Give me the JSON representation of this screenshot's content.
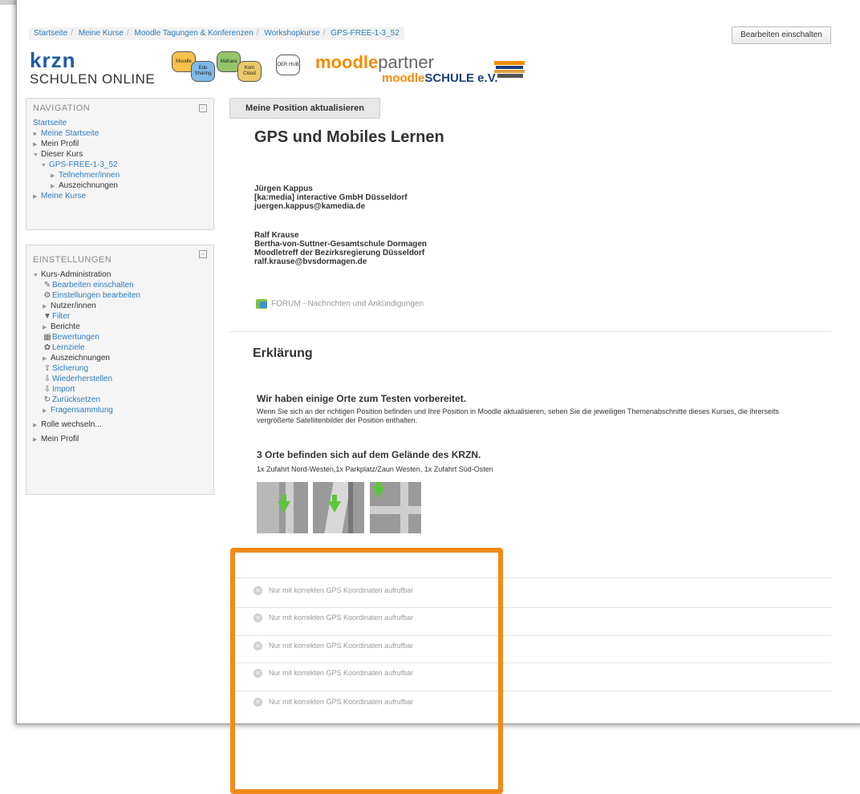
{
  "breadcrumb": [
    "Startseite",
    "Meine Kurse",
    "Moodle Tagungen & Konferenzen",
    "Workshopkurse",
    "GPS-FREE-1-3_52"
  ],
  "header": {
    "edit_button": "Bearbeiten einschalten",
    "logo_krzn": "krzn",
    "logo_schulen": "SCHULEN ONLINE",
    "badges": [
      "Moodle",
      "Edu Sharing",
      "Mahara",
      "Kom Cloud",
      "OER HUB"
    ],
    "logo_partner_a": "moodle",
    "logo_partner_b": "partner",
    "logo_schule_a": "moodle",
    "logo_schule_b": "SCHULE e.V."
  },
  "navigation": {
    "title": "NAVIGATION",
    "items": [
      "Startseite",
      "Meine Startseite",
      "Mein Profil",
      "Dieser Kurs",
      "GPS-FREE-1-3_52",
      "Teilnehmer/innen",
      "Auszeichnungen",
      "Meine Kurse"
    ]
  },
  "settings": {
    "title": "EINSTELLUNGEN",
    "items": [
      "Kurs-Administration",
      "Bearbeiten einschalten",
      "Einstellungen bearbeiten",
      "Nutzer/innen",
      "Filter",
      "Berichte",
      "Bewertungen",
      "Lernziele",
      "Auszeichnungen",
      "Sicherung",
      "Wiederherstellen",
      "Import",
      "Zurücksetzen",
      "Fragensammlung",
      "Rolle wechseln...",
      "Mein Profil"
    ]
  },
  "main": {
    "position_button": "Meine Position aktualisieren",
    "title": "GPS und Mobiles Lernen",
    "person1": [
      "Jürgen Kappus",
      "[ka:media] interactive GmbH Düsseldorf",
      "juergen.kappus@kamedia.de"
    ],
    "person2": [
      "Ralf Krause",
      "Bertha-von-Suttner-Gesamtschule Dormagen",
      "Moodletreff der Bezirksregierung Düsseldorf",
      "ralf.krause@bvsdormagen.de"
    ],
    "forum": "FORUM - Nachrichten und Ankündigungen",
    "section_title": "Erklärung",
    "heading1": "Wir haben einige Orte zum Testen vorbereitet.",
    "para1": "Wenn Sie sich an der richtigen Position befinden und Ihre Position in Moodle aktualisieren, sehen Sie die jeweiligen Themenabschnitte dieses Kurses, die ihrerseits vergrößerte Satellitenbilder der Position enthalten.",
    "heading2": "3 Orte befinden sich auf dem Gelände des KRZN.",
    "para2": "1x Zufahrt Nord-Westen,1x Parkplatz/Zaun Westen, 1x Zufahrt Süd-Osten",
    "locked_sections": [
      "Nur mit korrekten GPS Koordinaten aufrufbar",
      "Nur mit korrekten GPS Koordinaten aufrufbar",
      "Nur mit korrekten GPS Koordinaten aufrufbar",
      "Nur mit korrekten GPS Koordinaten aufrufbar",
      "Nur mit korrekten GPS Koordinaten aufrufbar"
    ]
  },
  "colors": {
    "link": "#2d7dbf",
    "highlight": "#f28a1a",
    "krzn_blue": "#1f5aa6"
  }
}
